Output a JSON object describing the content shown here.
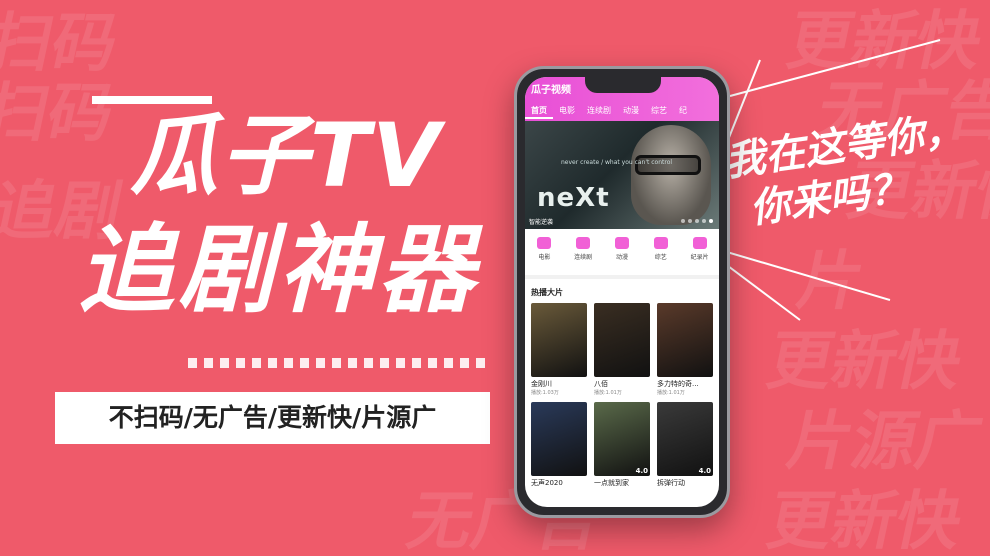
{
  "background": {
    "color": "#ef5a6a",
    "pattern_words": [
      "瓜子TV",
      "无广告",
      "更新快",
      "片源广",
      "扫码",
      "追剧",
      "更新快",
      "片源广",
      "无广告",
      "更新快",
      "片",
      "更新快"
    ]
  },
  "headline": {
    "line1": "瓜子TV",
    "line2": "追剧神器"
  },
  "tagline": "不扫码/无广告/更新快/片源广",
  "speech": {
    "line1": "我在这等你，",
    "line2": "你来吗？"
  },
  "phone": {
    "app_title": "瓜子视频",
    "tabs": [
      "首页",
      "电影",
      "连续剧",
      "动漫",
      "综艺",
      "纪"
    ],
    "banner": {
      "title": "neXt",
      "small_text": "never create / what you can't control",
      "caption": "智能逆袭"
    },
    "categories": [
      {
        "label": "电影",
        "icon": "film-icon"
      },
      {
        "label": "连续剧",
        "icon": "tv-icon"
      },
      {
        "label": "动漫",
        "icon": "anime-icon"
      },
      {
        "label": "综艺",
        "icon": "variety-icon"
      },
      {
        "label": "纪录片",
        "icon": "documentary-icon"
      }
    ],
    "section_title": "热播大片",
    "movies": [
      {
        "name": "金刚川",
        "plays": "播放:1.03万",
        "score": "",
        "color": "#6a5a3a"
      },
      {
        "name": "八佰",
        "plays": "播放:1.01万",
        "score": "",
        "color": "#3a2e22"
      },
      {
        "name": "多力特的奇...",
        "plays": "播放:1.01万",
        "score": "",
        "color": "#5a3a2a"
      },
      {
        "name": "无声2020",
        "plays": "",
        "score": "",
        "color": "#2a3a5a"
      },
      {
        "name": "一点就到家",
        "plays": "",
        "score": "4.0",
        "color": "#5a6a4a"
      },
      {
        "name": "拆弹行动",
        "plays": "",
        "score": "4.0",
        "color": "#3a3a3a"
      }
    ],
    "accent": "#ee55d8"
  }
}
